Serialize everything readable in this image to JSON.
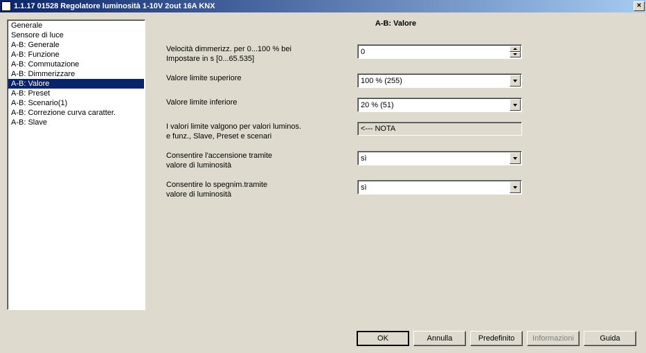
{
  "window": {
    "title": "1.1.17 01528 Regolatore luminosità 1-10V 2out 16A KNX"
  },
  "sidebar": {
    "items": [
      "Generale",
      "Sensore di luce",
      "A-B: Generale",
      "A-B: Funzione",
      "A-B: Commutazione",
      "A-B: Dimmerizzare",
      "A-B: Valore",
      "A-B: Preset",
      "A-B: Scenario(1)",
      "A-B: Correzione curva caratter.",
      "A-B: Slave"
    ],
    "selectedIndex": 6
  },
  "main": {
    "title": "A-B: Valore",
    "params": [
      {
        "label1": "Velocità dimmerizz. per 0...100 % bei",
        "label2": "Impostare in s [0...65.535]",
        "type": "spinner",
        "value": "0"
      },
      {
        "label1": "Valore limite superiore",
        "label2": "",
        "type": "select",
        "value": "100 % (255)"
      },
      {
        "label1": "Valore limite inferiore",
        "label2": "",
        "type": "select",
        "value": "20 %  (51)"
      },
      {
        "label1": "I valori limite valgono per valori luminos.",
        "label2": "e funz., Slave, Preset e scenari",
        "type": "readonly",
        "value": "<--- NOTA"
      },
      {
        "label1": "Consentire l'accensione tramite",
        "label2": "valore di luminosità",
        "type": "select",
        "value": "sì"
      },
      {
        "label1": "Consentire lo spegnim.tramite",
        "label2": "valore di luminosità",
        "type": "select",
        "value": "sì"
      }
    ]
  },
  "buttons": {
    "ok": "OK",
    "cancel": "Annulla",
    "default": "Predefinito",
    "info": "Informazioni",
    "help": "Guida"
  }
}
